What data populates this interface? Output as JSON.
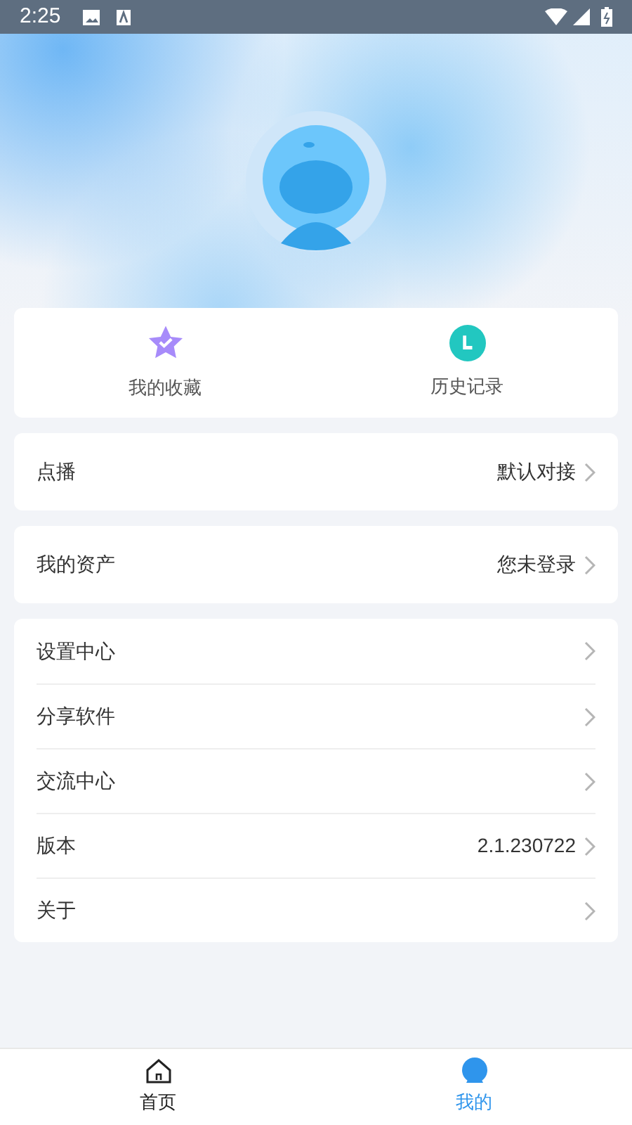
{
  "status_bar": {
    "time": "2:25"
  },
  "quick_actions": [
    {
      "kind": "favorites",
      "label": "我的收藏"
    },
    {
      "kind": "history",
      "label": "历史记录"
    }
  ],
  "groups": [
    {
      "rows": [
        {
          "label": "点播",
          "value": "默认对接"
        }
      ]
    },
    {
      "rows": [
        {
          "label": "我的资产",
          "value": "您未登录"
        }
      ]
    },
    {
      "rows": [
        {
          "label": "设置中心"
        },
        {
          "label": "分享软件"
        },
        {
          "label": "交流中心"
        },
        {
          "label": "版本",
          "value": "2.1.230722"
        },
        {
          "label": "关于"
        }
      ]
    }
  ],
  "tabs": [
    {
      "kind": "home",
      "label": "首页",
      "selected": false
    },
    {
      "kind": "mine",
      "label": "我的",
      "selected": true
    }
  ]
}
